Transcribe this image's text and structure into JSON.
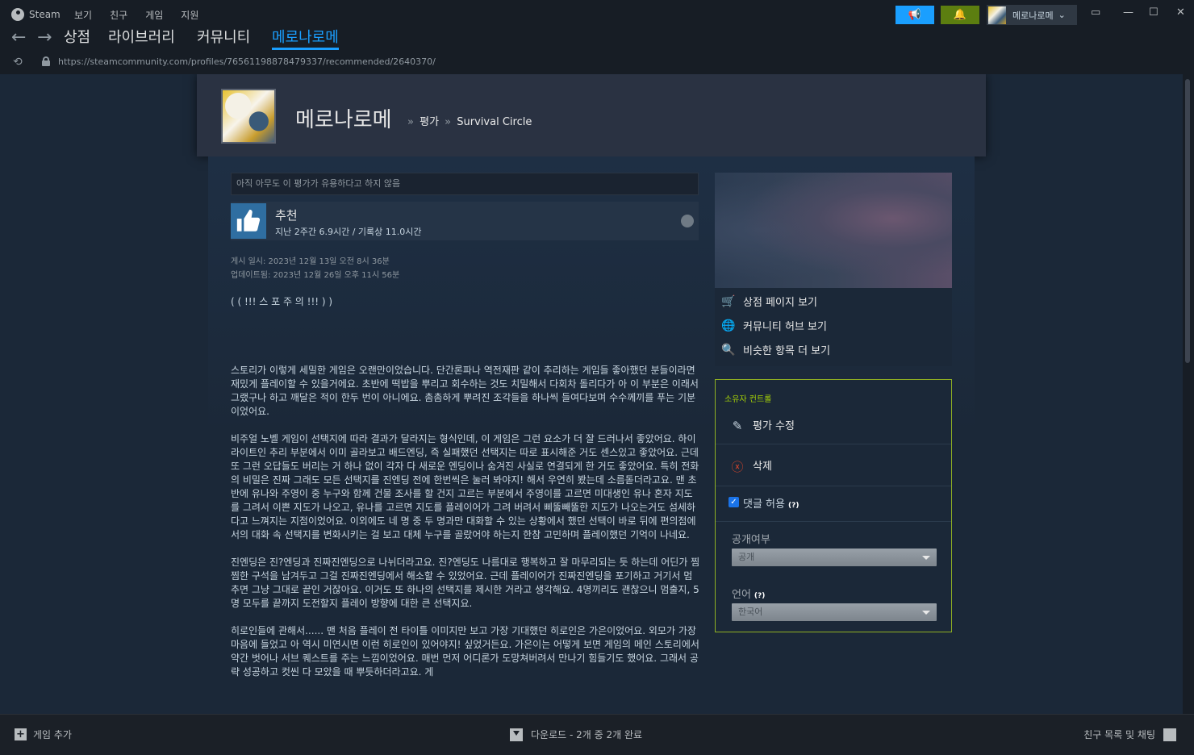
{
  "app": {
    "title": "Steam",
    "menu": [
      "보기",
      "친구",
      "게임",
      "지원"
    ],
    "username": "메로나로메"
  },
  "nav": {
    "tabs": [
      "상점",
      "라이브러리",
      "커뮤니티",
      "메로나로메"
    ],
    "active_tab": "메로나로메"
  },
  "url": "https://steamcommunity.com/profiles/76561198878479337/recommended/2640370/",
  "profile": {
    "name": "메로나로메",
    "breadcrumb_sep": "»",
    "crumb_reviews": "평가",
    "crumb_game": "Survival Circle"
  },
  "review": {
    "helpful_text": "아직 아무도 이 평가가 유용하다고 하지 않음",
    "recommend_label": "추천",
    "hours": "지난 2주간 6.9시간 / 기록상 11.0시간",
    "posted": "게시 일시: 2023년 12월 13일 오전 8시 36분",
    "updated": "업데이트됨: 2023년 12월 26일 오후 11시 56분",
    "spoiler": "( ( !!! 스 포 주 의 !!! ) )",
    "paragraphs": [
      "스토리가 이렇게 세밀한 게임은 오랜만이었습니다. 단간론파나 역전재판 같이 추리하는 게임들 좋아했던 분들이라면 재밌게 플레이할 수 있을거에요. 초반에 떡밥을 뿌리고 회수하는 것도 치밀해서 다회차 돌리다가 아 이 부분은 이래서 그랬구나 하고 깨달은 적이 한두 번이 아니에요. 촘촘하게 뿌려진 조각들을 하나씩 들여다보며 수수께끼를 푸는 기분이었어요.",
      "비주얼 노벨 게임이 선택지에 따라 결과가 달라지는 형식인데, 이 게임은 그런 요소가 더 잘 드러나서 좋았어요. 하이라이트인 추리 부분에서 이미 골라보고 배드엔딩, 즉 실패했던 선택지는 따로 표시해준 거도 센스있고 좋았어요. 근데 또 그런 오답들도 버리는 거 하나 없이 각자 다 새로운 엔딩이나 숨겨진 사실로 연결되게 한 거도 좋았어요. 특히 전화의 비밀은 진짜 그래도 모든 선택지를 진엔딩 전에 한번씩은 눌러 봐야지! 해서 우연히 봤는데 소름돋더라고요. 맨 초반에 유나와 주영이 중 누구와 함께 건물 조사를 할 건지 고르는 부분에서 주영이를 고르면 미대생인 유나 혼자 지도를 그려서 이쁜 지도가 나오고, 유나를 고르면 지도를 플레이어가 그려 버려서 삐뚤빼뚤한 지도가 나오는거도 섬세하다고 느껴지는 지점이었어요. 이외에도 네 명 중 두 명과만 대화할 수 있는 상황에서 했던 선택이 바로 뒤에 편의점에서의 대화 속 선택지를 변화시키는 걸 보고 대체 누구를 골랐어야 하는지 한참 고민하며 플레이했던 기억이 나네요.",
      "진엔딩은 진?엔딩과 진짜진엔딩으로 나뉘더라고요. 진?엔딩도 나름대로 행복하고 잘 마무리되는 듯 하는데 어딘가 찜찜한 구석을 남겨두고 그걸 진짜진엔딩에서 해소할 수 있었어요. 근데 플레이어가 진짜진엔딩을 포기하고 거기서 멈추면 그냥 그대로 끝인 거잖아요. 이거도 또 하나의 선택지를 제시한 거라고 생각해요. 4명끼리도 괜찮으니 멈출지, 5명 모두를 끝까지 도전할지 플레이 방향에 대한 큰 선택지요.",
      "히로인들에 관해서...... 맨 처음 플레이 전 타이틀 이미지만 보고 가장 기대했던 히로인은 가은이었어요. 외모가 가장 마음에 들었고 아 역시 미연시면 이런 히로인이 있어야지! 싶었거든요. 가은이는 어떻게 보면 게임의 메인 스토리에서 약간 벗어나 서브 퀘스트를 주는 느낌이었어요. 매번 먼저 어디론가 도망쳐버려서 만나기 힘들기도 했어요. 그래서 공략 성공하고 컷씬 다 모았을 때 뿌듯하더라고요. 게"
    ]
  },
  "sidebar": {
    "store_link": "상점 페이지 보기",
    "hub_link": "커뮤니티 허브 보기",
    "similar_link": "비슷한 항목 더 보기"
  },
  "owner": {
    "title": "소유자 컨트롤",
    "edit": "평가 수정",
    "delete": "삭제",
    "allow_comments": "댓글 허용",
    "help": "(?)",
    "visibility_label": "공개여부",
    "visibility_value": "공개",
    "language_label": "언어",
    "language_value": "한국어"
  },
  "bottom": {
    "add_game": "게임 추가",
    "downloads": "다운로드 - 2개 중 2개 완료",
    "friends": "친구 목록 및 채팅"
  },
  "colors": {
    "accent": "#1a9fff",
    "owner_border": "#8fb023",
    "owner_title": "#a4d007"
  }
}
